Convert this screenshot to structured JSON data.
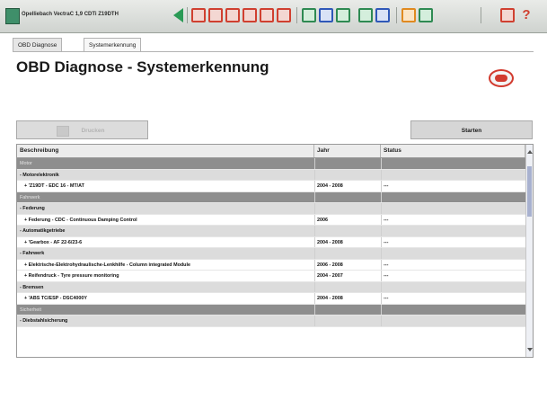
{
  "toolbar": {
    "title": "Opelliebach VectraC 1,9 CDTi Z19DTH",
    "help_label": "?"
  },
  "tabs": [
    {
      "label": "OBD Diagnose"
    },
    {
      "label": "Systemerkennung"
    }
  ],
  "page": {
    "title": "OBD Diagnose - Systemerkennung"
  },
  "buttons": {
    "disabled_label": "Drucken",
    "start_label": "Starten"
  },
  "table": {
    "headers": [
      "Beschreibung",
      "Jahr",
      "Status"
    ],
    "rows": [
      {
        "type": "cat",
        "desc": "Motor",
        "year": "",
        "status": ""
      },
      {
        "type": "sub",
        "desc": "- Motorelektronik",
        "year": "",
        "status": ""
      },
      {
        "type": "item",
        "desc": "+ 'Z19DT - EDC 16 - MT/AT",
        "year": "2004 - 2008",
        "status": "---"
      },
      {
        "type": "cat",
        "desc": "Fahrwerk",
        "year": "",
        "status": ""
      },
      {
        "type": "sub",
        "desc": "- Federung",
        "year": "",
        "status": ""
      },
      {
        "type": "item",
        "desc": "+ Federung - CDC - Continuous Damping Control",
        "year": "2006",
        "status": "---"
      },
      {
        "type": "sub",
        "desc": "- Automatikgetriebe",
        "year": "",
        "status": ""
      },
      {
        "type": "item",
        "desc": "+ 'Gearbox - AF 22-6/23-6",
        "year": "2004 - 2008",
        "status": "---"
      },
      {
        "type": "sub",
        "desc": "- Fahrwerk",
        "year": "",
        "status": ""
      },
      {
        "type": "item",
        "desc": "+ Elektrische-Elektrohydraulische-Lenkhilfe - Column integrated Module",
        "year": "2006 - 2008",
        "status": "---"
      },
      {
        "type": "item",
        "desc": "+ Reifendruck - Tyre pressure monitoring",
        "year": "2004 - 2007",
        "status": "---"
      },
      {
        "type": "sub",
        "desc": "- Bremsen",
        "year": "",
        "status": ""
      },
      {
        "type": "item",
        "desc": "+ 'ABS TC/ESP - DSC4000Y",
        "year": "2004 - 2008",
        "status": "---"
      },
      {
        "type": "cat",
        "desc": "Sicherheit",
        "year": "",
        "status": ""
      },
      {
        "type": "sub",
        "desc": "- Diebstahlsicherung",
        "year": "",
        "status": ""
      }
    ]
  }
}
